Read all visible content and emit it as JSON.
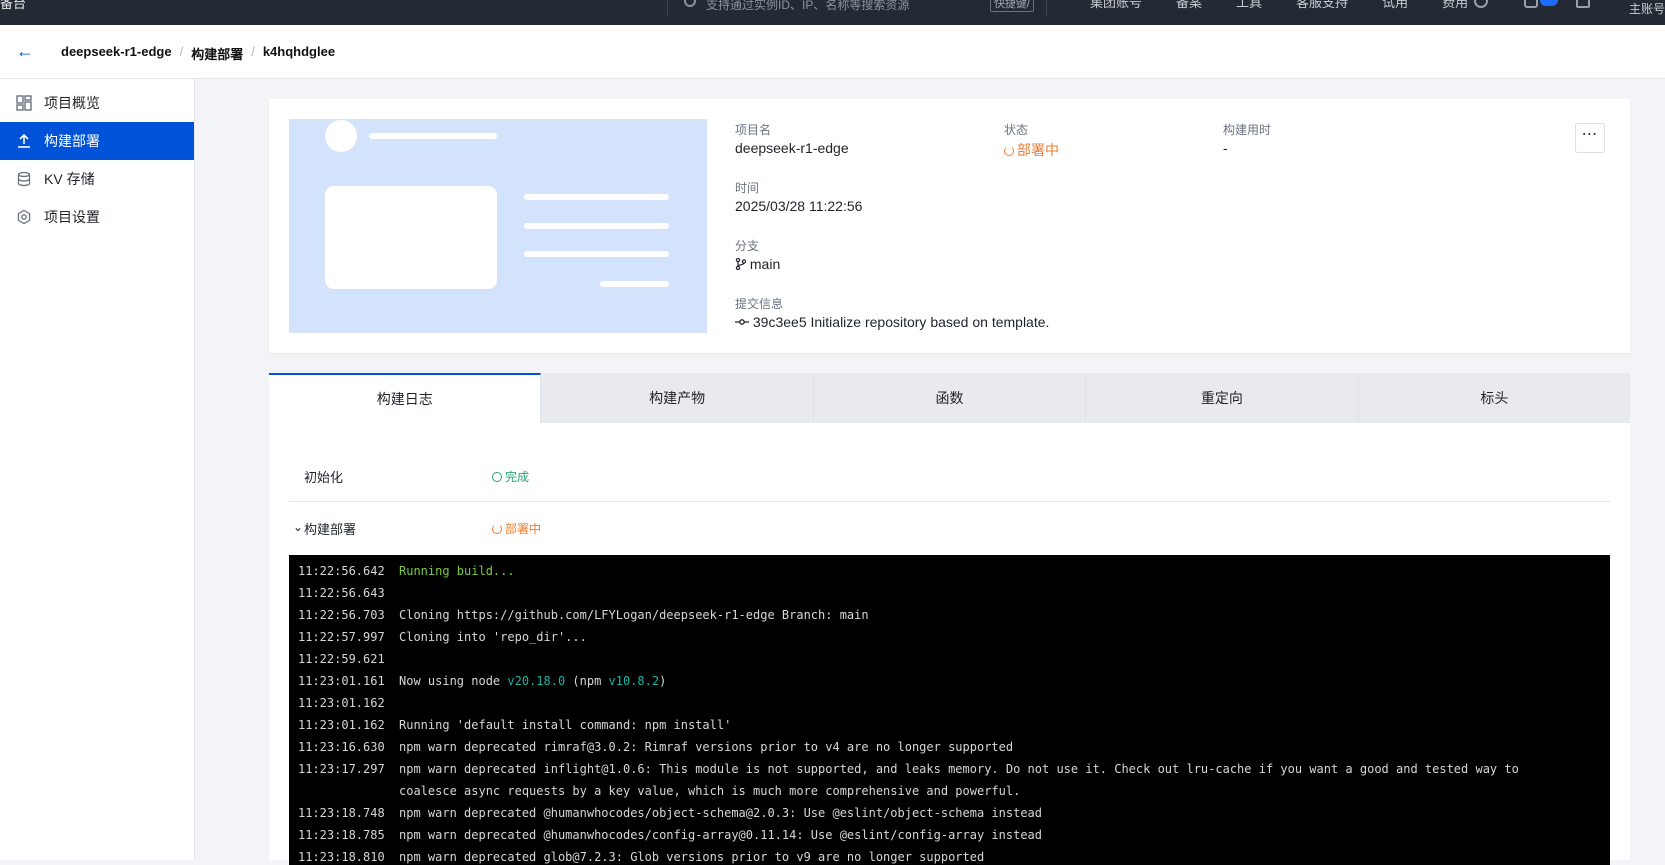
{
  "topbar": {
    "left_cut_text": "备台",
    "search_placeholder": "支持通过实例ID、IP、名称等搜索资源",
    "search_shortcut": "快捷键/",
    "nav": [
      "集团账号",
      "备案",
      "工具",
      "客服支持",
      "试用",
      "费用"
    ],
    "account": "主账号"
  },
  "breadcrumb": {
    "back_icon": "arrow-left-icon",
    "items": [
      "deepseek-r1-edge",
      "构建部署",
      "k4hqhdglee"
    ],
    "separator": "/"
  },
  "sidebar": {
    "items": [
      {
        "label": "项目概览",
        "icon": "dashboard-icon",
        "active": false
      },
      {
        "label": "构建部署",
        "icon": "upload-icon",
        "active": true
      },
      {
        "label": "KV 存储",
        "icon": "database-icon",
        "active": false
      },
      {
        "label": "项目设置",
        "icon": "settings-icon",
        "active": false
      }
    ]
  },
  "project": {
    "name_label": "项目名",
    "name": "deepseek-r1-edge",
    "status_label": "状态",
    "status": "部署中",
    "duration_label": "构建用时",
    "duration": "-",
    "time_label": "时间",
    "time": "2025/03/28 11:22:56",
    "branch_label": "分支",
    "branch": "main",
    "commit_label": "提交信息",
    "commit": "39c3ee5 Initialize repository based on template.",
    "more": "⋯"
  },
  "tabs": [
    "构建日志",
    "构建产物",
    "函数",
    "重定向",
    "标头"
  ],
  "steps": [
    {
      "name": "初始化",
      "status": "完成",
      "chevron": ""
    },
    {
      "name": "构建部署",
      "status": "部署中",
      "chevron": "⌄"
    }
  ],
  "colors": {
    "accent": "#0052d9",
    "deploying": "#ed7b2f",
    "success": "#2ba471",
    "terminal_bg": "#000000"
  },
  "log": [
    {
      "ts": "11:22:56.642",
      "parts": [
        {
          "t": "Running build...",
          "c": "green"
        }
      ]
    },
    {
      "ts": "11:22:56.643",
      "parts": []
    },
    {
      "ts": "11:22:56.703",
      "parts": [
        {
          "t": "Cloning https://github.com/LFYLogan/deepseek-r1-edge Branch: main"
        }
      ]
    },
    {
      "ts": "11:22:57.997",
      "parts": [
        {
          "t": "Cloning into 'repo_dir'..."
        }
      ]
    },
    {
      "ts": "11:22:59.621",
      "parts": []
    },
    {
      "ts": "11:23:01.161",
      "parts": [
        {
          "t": "Now using node "
        },
        {
          "t": "v20.18.0",
          "c": "cyan"
        },
        {
          "t": " (npm "
        },
        {
          "t": "v10.8.2",
          "c": "cyan"
        },
        {
          "t": ")"
        }
      ]
    },
    {
      "ts": "11:23:01.162",
      "parts": []
    },
    {
      "ts": "11:23:01.162",
      "parts": [
        {
          "t": "Running 'default install command: npm install'"
        }
      ]
    },
    {
      "ts": "11:23:16.630",
      "parts": [
        {
          "t": "npm warn deprecated rimraf@3.0.2: Rimraf versions prior to v4 are no longer supported"
        }
      ]
    },
    {
      "ts": "11:23:17.297",
      "parts": [
        {
          "t": "npm warn deprecated inflight@1.0.6: This module is not supported, and leaks memory. Do not use it. Check out lru-cache if you want a good and tested way to coalesce async requests by a key value, which is much more comprehensive and powerful."
        }
      ]
    },
    {
      "ts": "11:23:18.748",
      "parts": [
        {
          "t": "npm warn deprecated @humanwhocodes/object-schema@2.0.3: Use @eslint/object-schema instead"
        }
      ]
    },
    {
      "ts": "11:23:18.785",
      "parts": [
        {
          "t": "npm warn deprecated @humanwhocodes/config-array@0.11.14: Use @eslint/config-array instead"
        }
      ]
    },
    {
      "ts": "11:23:18.810",
      "parts": [
        {
          "t": "npm warn deprecated glob@7.2.3: Glob versions prior to v9 are no longer supported"
        }
      ]
    }
  ]
}
